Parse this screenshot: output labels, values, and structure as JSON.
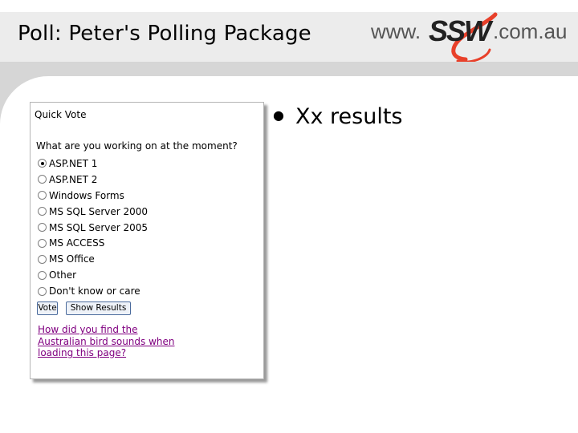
{
  "slide": {
    "title": "Poll: Peter's Polling Package",
    "bullet": "Xx results"
  },
  "logo": {
    "prefix": "www.",
    "brand": "SSW",
    "suffix": ".com.au",
    "colors": {
      "swoosh": "#e8402a",
      "text": "#555555"
    }
  },
  "poll": {
    "title": "Quick Vote",
    "question": "What are you working on at the moment?",
    "options": [
      {
        "label": "ASP.NET 1",
        "selected": true
      },
      {
        "label": "ASP.NET 2",
        "selected": false
      },
      {
        "label": "Windows Forms",
        "selected": false
      },
      {
        "label": "MS SQL Server 2000",
        "selected": false
      },
      {
        "label": "MS SQL Server 2005",
        "selected": false
      },
      {
        "label": "MS ACCESS",
        "selected": false
      },
      {
        "label": "MS Office",
        "selected": false
      },
      {
        "label": "Other",
        "selected": false
      },
      {
        "label": "Don't know or care",
        "selected": false
      }
    ],
    "vote_label": "Vote",
    "results_label": "Show Results",
    "link_text": "How did you find the Australian bird sounds when loading this page?"
  }
}
